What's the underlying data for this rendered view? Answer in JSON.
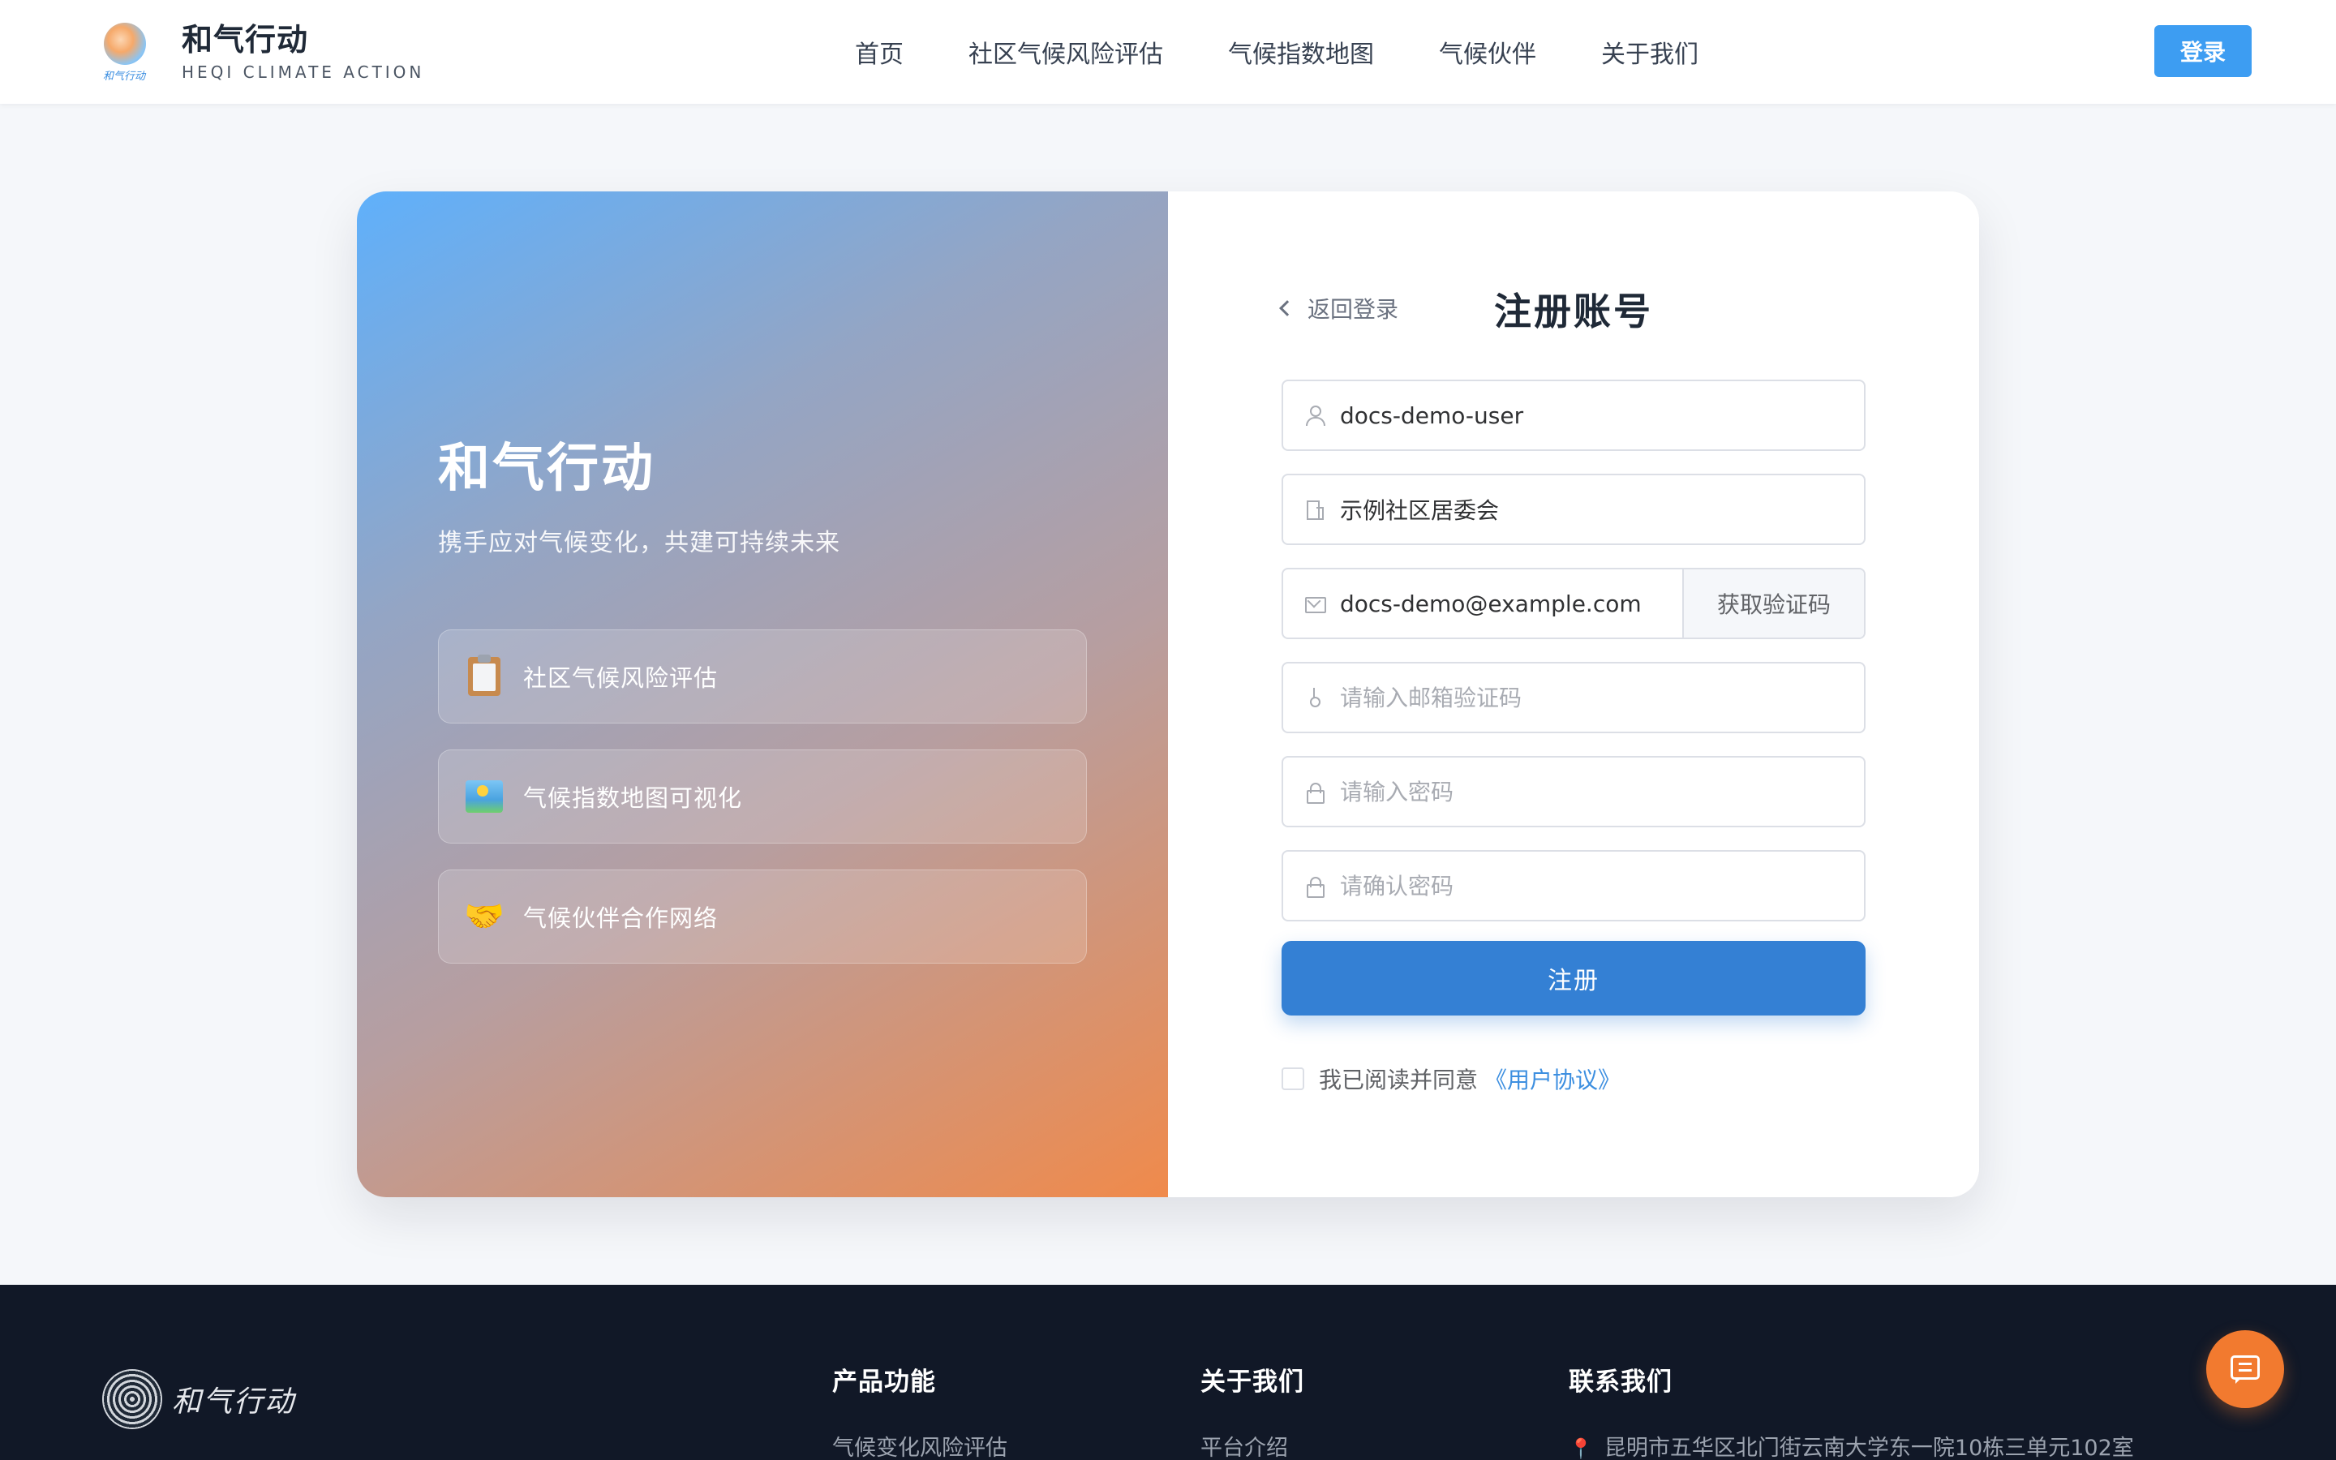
{
  "header": {
    "brand": {
      "cn": "和气行动",
      "en": "HEQI CLIMATE ACTION",
      "logo_script": "和气行动"
    },
    "nav": [
      {
        "label": "首页"
      },
      {
        "label": "社区气候风险评估"
      },
      {
        "label": "气候指数地图"
      },
      {
        "label": "气候伙伴"
      },
      {
        "label": "关于我们"
      }
    ],
    "login_label": "登录"
  },
  "hero": {
    "title": "和气行动",
    "subtitle": "携手应对气候变化，共建可持续未来",
    "features": [
      {
        "icon": "clipboard-icon",
        "label": "社区气候风险评估"
      },
      {
        "icon": "map-icon",
        "label": "气候指数地图可视化"
      },
      {
        "icon": "handshake-icon",
        "label": "气候伙伴合作网络"
      }
    ]
  },
  "form": {
    "back_label": "返回登录",
    "title": "注册账号",
    "username": {
      "value": "docs-demo-user",
      "placeholder": ""
    },
    "organization": {
      "value": "示例社区居委会",
      "placeholder": ""
    },
    "email": {
      "value": "docs-demo@example.com",
      "placeholder": ""
    },
    "code_button": "获取验证码",
    "code": {
      "value": "",
      "placeholder": "请输入邮箱验证码"
    },
    "password": {
      "value": "",
      "placeholder": "请输入密码"
    },
    "confirm_password": {
      "value": "",
      "placeholder": "请确认密码"
    },
    "submit_label": "注册",
    "agree_text": "我已阅读并同意",
    "agree_link": "《用户协议》",
    "agree_checked": false
  },
  "footer": {
    "logo_script": "和气行动",
    "columns": [
      {
        "heading": "产品功能",
        "links": [
          "气候变化风险评估"
        ]
      },
      {
        "heading": "关于我们",
        "links": [
          "平台介绍"
        ]
      },
      {
        "heading": "联系我们",
        "links": [
          "昆明市五华区北门街云南大学东一院10栋三单元102室"
        ]
      }
    ]
  },
  "colors": {
    "primary": "#3d9df2",
    "submit": "#3480d4",
    "accent_orange": "#f27a2f",
    "footer_bg": "#111827",
    "page_bg": "#f5f7fa"
  }
}
